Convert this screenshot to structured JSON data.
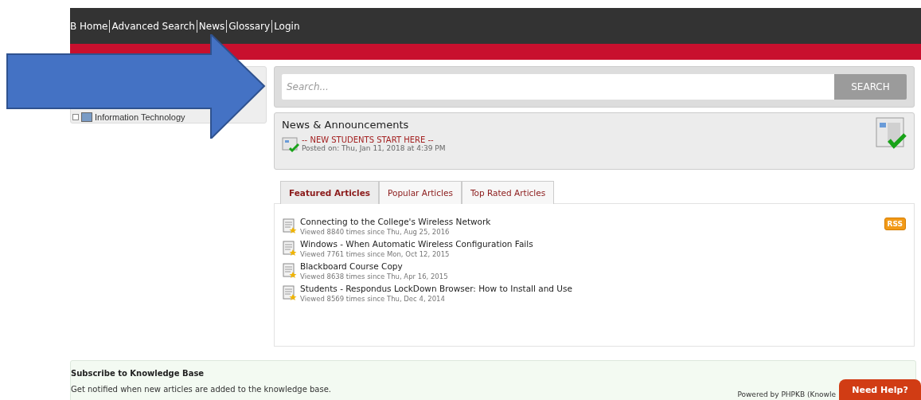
{
  "nav": {
    "links": [
      "B Home",
      "Advanced Search",
      "News",
      "Glossary",
      "Login"
    ]
  },
  "sidebar": {
    "items": [
      {
        "label": "Information Technology"
      }
    ]
  },
  "search": {
    "placeholder": "Search...",
    "button": "SEARCH"
  },
  "news": {
    "title": "News & Announcements",
    "items": [
      {
        "title": "-- NEW STUDENTS START HERE --",
        "posted": "Posted on: Thu, Jan 11, 2018 at 4:39 PM"
      }
    ]
  },
  "tabs": [
    {
      "label": "Featured Articles",
      "selected": true
    },
    {
      "label": "Popular Articles",
      "selected": false
    },
    {
      "label": "Top Rated Articles",
      "selected": false
    }
  ],
  "rss": "RSS",
  "articles": [
    {
      "title": "Connecting to the College's Wireless Network",
      "meta": "Viewed 8840 times since Thu, Aug 25, 2016"
    },
    {
      "title": "Windows - When Automatic Wireless Configuration Fails",
      "meta": "Viewed 7761 times since Mon, Oct 12, 2015"
    },
    {
      "title": "Blackboard Course Copy",
      "meta": "Viewed 8638 times since Thu, Apr 16, 2015"
    },
    {
      "title": "Students - Respondus LockDown Browser: How to Install and Use",
      "meta": "Viewed 8569 times since Thu, Dec 4, 2014"
    }
  ],
  "subscribe": {
    "title": "Subscribe to Knowledge Base",
    "text": "Get notified when new articles are added to the knowledge base."
  },
  "powered_by": "Powered by PHPKB (Knowle",
  "help_button": "Need Help?"
}
